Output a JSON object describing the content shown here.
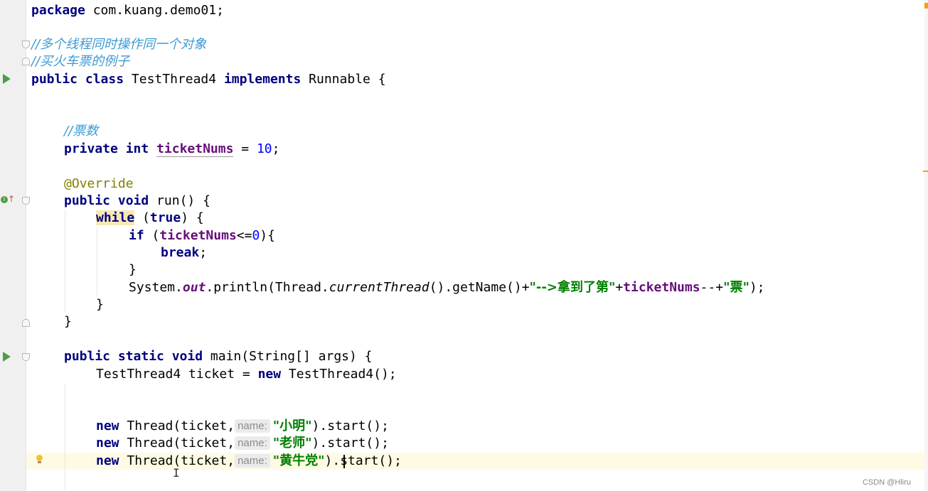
{
  "code": {
    "package_kw": "package",
    "package_name": "com.kuang.demo01;",
    "comment1": "//多个线程同时操作同一个对象",
    "comment2": "//买火车票的例子",
    "class_kw": "public class",
    "class_name": "TestThread4",
    "implements_kw": "implements",
    "interface_name": "Runnable {",
    "comment3": "//票数",
    "field_kw": "private int",
    "field_name": "ticketNums",
    "field_assign": "=",
    "field_value": "10",
    "semicolon": ";",
    "annotation": "@Override",
    "run_kw": "public void",
    "run_sig": "run() {",
    "while_kw": "while",
    "while_open": "(",
    "true_kw": "true",
    "while_close": ") {",
    "if_kw": "if",
    "if_open": "(",
    "if_field": "ticketNums",
    "if_cmp": "<=",
    "if_zero": "0",
    "if_close": "){",
    "break_kw": "break",
    "break_semi": ";",
    "brace_close": "}",
    "sys": "System.",
    "out": "out",
    "println": ".println(Thread.",
    "current_thread": "currentThread",
    "get_name": "().getName()+",
    "str_arrow": "\"-->拿到了第\"",
    "plus1": "+",
    "print_field": "ticketNums",
    "decr": "--+",
    "str_piao": "\"票\"",
    "print_end": ");",
    "main_kw": "public static void",
    "main_sig": "main(String[] args) {",
    "ticket_decl": "TestThread4 ticket = ",
    "new_kw": "new",
    "ticket_ctor": " TestThread4();",
    "thread_call": " Thread(ticket,",
    "hint_name": "name:",
    "thread_name1": "\"小明\"",
    "thread_name2": "\"老师\"",
    "thread_name3": "\"黄牛党\"",
    "start_call": ").start();"
  },
  "watermark": "CSDN @Hliru",
  "icons": {
    "run": "run-gutter-icon",
    "fold": "fold-marker-icon",
    "override": "override-gutter-icon",
    "bulb": "intention-bulb-icon"
  },
  "colors": {
    "keyword": "#000080",
    "comment": "#3c9ad3",
    "field": "#660e7a",
    "string": "#008000",
    "number": "#0000ff",
    "annotation": "#808000",
    "current_line": "#fffae3"
  }
}
